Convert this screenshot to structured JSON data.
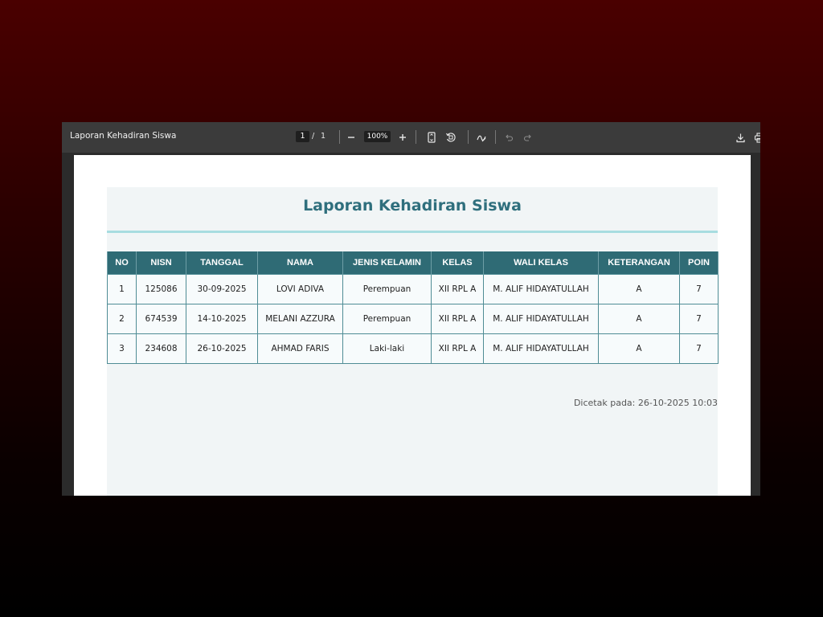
{
  "viewer": {
    "doc_title": "Laporan Kehadiran Siswa",
    "current_page": "1",
    "page_separator": "/",
    "total_pages": "1",
    "zoom": "100%"
  },
  "report": {
    "title": "Laporan Kehadiran Siswa",
    "columns": {
      "no": "NO",
      "nisn": "NISN",
      "tanggal": "TANGGAL",
      "nama": "NAMA",
      "jenis_kelamin": "JENIS KELAMIN",
      "kelas": "KELAS",
      "wali_kelas": "WALI KELAS",
      "keterangan": "KETERANGAN",
      "poin": "POIN"
    },
    "rows": [
      {
        "no": "1",
        "nisn": "125086",
        "tanggal": "30-09-2025",
        "nama": "LOVI ADIVA",
        "jenis_kelamin": "Perempuan",
        "kelas": "XII RPL A",
        "wali_kelas": "M. ALIF HIDAYATULLAH",
        "keterangan": "A",
        "poin": "7"
      },
      {
        "no": "2",
        "nisn": "674539",
        "tanggal": "14-10-2025",
        "nama": "MELANI AZZURA",
        "jenis_kelamin": "Perempuan",
        "kelas": "XII RPL A",
        "wali_kelas": "M. ALIF HIDAYATULLAH",
        "keterangan": "A",
        "poin": "7"
      },
      {
        "no": "3",
        "nisn": "234608",
        "tanggal": "26-10-2025",
        "nama": "AHMAD FARIS",
        "jenis_kelamin": "Laki-laki",
        "kelas": "XII RPL A",
        "wali_kelas": "M. ALIF HIDAYATULLAH",
        "keterangan": "A",
        "poin": "7"
      }
    ],
    "printed_at": "Dicetak pada: 26-10-2025 10:03"
  },
  "icons": {
    "zoom_out": "minus-icon",
    "zoom_in": "plus-icon",
    "fit_page": "fit-page-icon",
    "rotate": "rotate-icon",
    "annotate": "draw-icon",
    "undo": "undo-icon",
    "redo": "redo-icon",
    "download": "download-icon",
    "print": "print-icon"
  },
  "colors": {
    "header_bg": "#2f6b75",
    "title_color": "#2f6f7d",
    "title_rule": "#a8dde0",
    "report_bg": "#f1f5f6",
    "toolbar_bg": "#3b3b3b"
  }
}
